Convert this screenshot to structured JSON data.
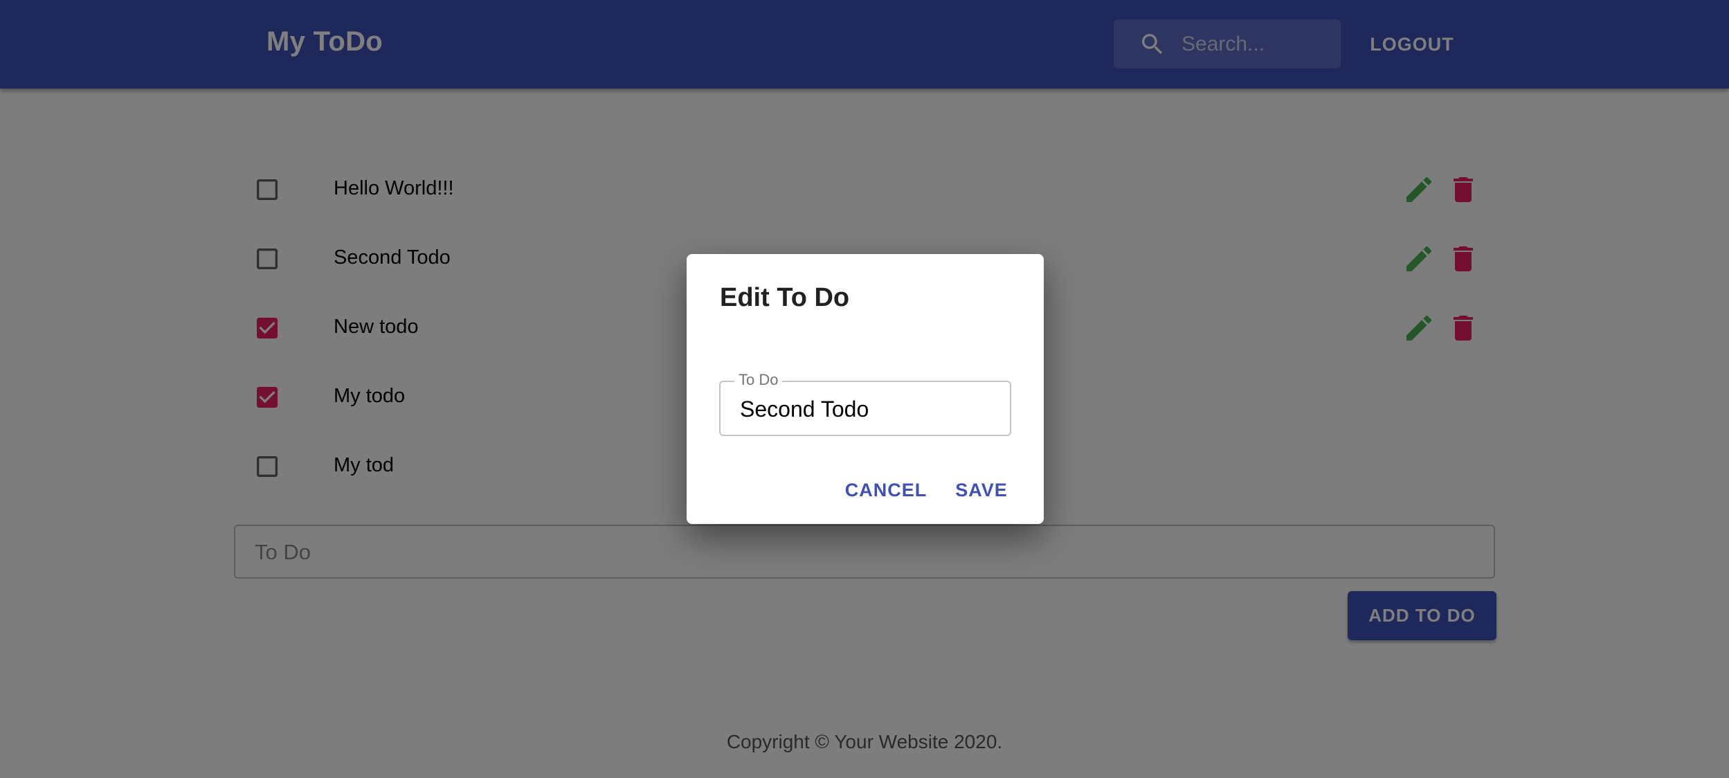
{
  "app": {
    "title": "My ToDo"
  },
  "search": {
    "placeholder": "Search..."
  },
  "header": {
    "logout_label": "LOGOUT"
  },
  "todos": [
    {
      "text": "Hello World!!!",
      "checked": false,
      "show_actions": true
    },
    {
      "text": "Second Todo",
      "checked": false,
      "show_actions": true
    },
    {
      "text": "New todo",
      "checked": true,
      "show_actions": true
    },
    {
      "text": "My todo",
      "checked": true,
      "show_actions": false
    },
    {
      "text": "My tod",
      "checked": false,
      "show_actions": false
    }
  ],
  "new_todo": {
    "placeholder": "To Do",
    "value": ""
  },
  "add_button_label": "ADD TO DO",
  "footer": {
    "text": "Copyright © Your Website 2020."
  },
  "dialog": {
    "title": "Edit To Do",
    "field_label": "To Do",
    "field_value": "Second Todo",
    "cancel_label": "CANCEL",
    "save_label": "SAVE"
  },
  "colors": {
    "primary": "#3f51b5",
    "accent_checkbox": "#e91e63",
    "edit_icon": "#4caf50",
    "delete_icon": "#e91e63"
  },
  "icons": {
    "search": "search-icon",
    "edit": "pencil-icon",
    "delete": "trash-icon",
    "checkbox_checked": "checkbox-checked-icon",
    "checkbox_unchecked": "checkbox-unchecked-icon"
  }
}
